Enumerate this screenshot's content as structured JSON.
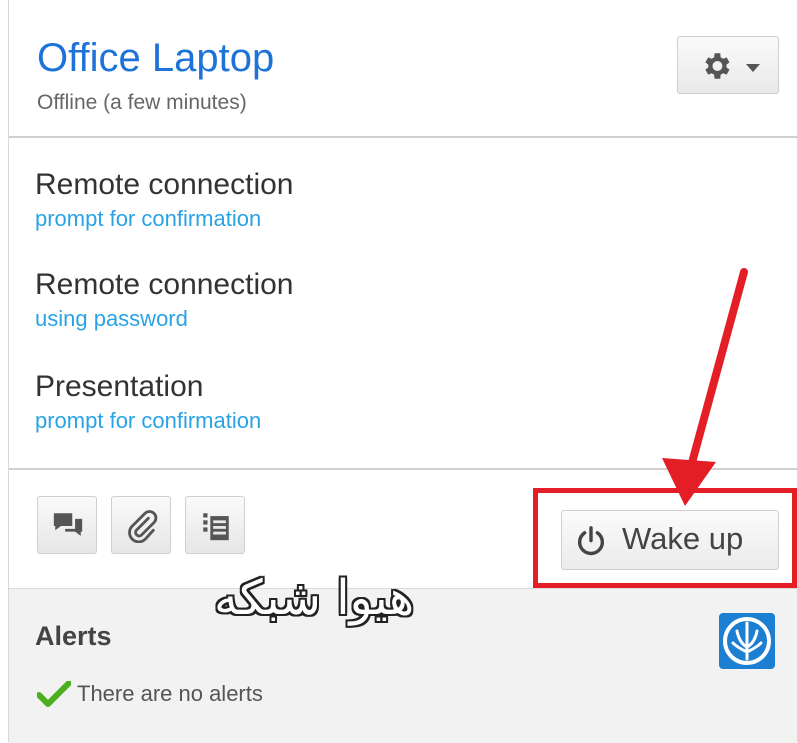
{
  "device": {
    "name": "Office Laptop",
    "status": "Offline (a few minutes)"
  },
  "connections": [
    {
      "title": "Remote connection",
      "subtitle": "prompt for confirmation"
    },
    {
      "title": "Remote connection",
      "subtitle": "using password"
    },
    {
      "title": "Presentation",
      "subtitle": "prompt for confirmation"
    }
  ],
  "toolbar": {
    "wake_label": "Wake up",
    "icons": [
      "chat-icon",
      "attachment-icon",
      "list-icon"
    ]
  },
  "alerts": {
    "title": "Alerts",
    "message": "There are no alerts"
  },
  "watermark": "هیوا شبکه",
  "colors": {
    "title": "#1e73d8",
    "link": "#29a3e6",
    "highlight": "#e41e26",
    "check": "#4caf1e",
    "logo": "#1d7fd2"
  }
}
